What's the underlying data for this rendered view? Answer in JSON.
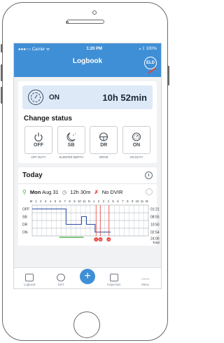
{
  "status_bar": {
    "carrier": "●●●○○ Carrier ᯤ",
    "time": "1:20 PM",
    "battery": "⇗ ᛒ 100%"
  },
  "header": {
    "title": "Logbook",
    "badge": "ELD"
  },
  "current": {
    "status": "ON",
    "time_left": "10h 52min"
  },
  "change_status": {
    "title": "Change status",
    "options": [
      {
        "code": "OFF",
        "label": "OFF DUTY"
      },
      {
        "code": "SB",
        "label": "SLEEPER BERTH"
      },
      {
        "code": "DR",
        "label": "DRIVE"
      },
      {
        "code": "ON",
        "label": "ON DUTY"
      }
    ]
  },
  "today": {
    "title": "Today",
    "day": "Mon",
    "date": "Aug 31",
    "duration": "12h 30m",
    "dvir": "No DVIR"
  },
  "log_graph": {
    "hour_labels": [
      "M",
      "1",
      "2",
      "3",
      "4",
      "5",
      "6",
      "7",
      "8",
      "9",
      "10",
      "11",
      "N",
      "1",
      "2",
      "3",
      "4",
      "5",
      "6",
      "7",
      "8",
      "9",
      "10",
      "11",
      "M"
    ],
    "rows": [
      {
        "label": "OFF",
        "total": "01:21"
      },
      {
        "label": "SB",
        "total": "08:55"
      },
      {
        "label": "DR",
        "total": "10:50"
      },
      {
        "label": "ON",
        "total": "02:54"
      }
    ],
    "grand_total": "24:00",
    "grand_total_label": "Total",
    "markers": [
      "9",
      "10",
      "14"
    ],
    "colors": {
      "line": "#2d4fa3",
      "marker": "#e8403a",
      "highlight": "#5ab552"
    }
  },
  "tabbar": {
    "items": [
      {
        "label": "Logbook",
        "icon": "logbook-icon"
      },
      {
        "label": "DOT",
        "icon": "dot-icon"
      },
      {
        "label": "+",
        "icon": "plus-icon"
      },
      {
        "label": "Inspection",
        "icon": "inspection-icon"
      },
      {
        "label": "Menu",
        "icon": "menu-icon"
      }
    ]
  }
}
